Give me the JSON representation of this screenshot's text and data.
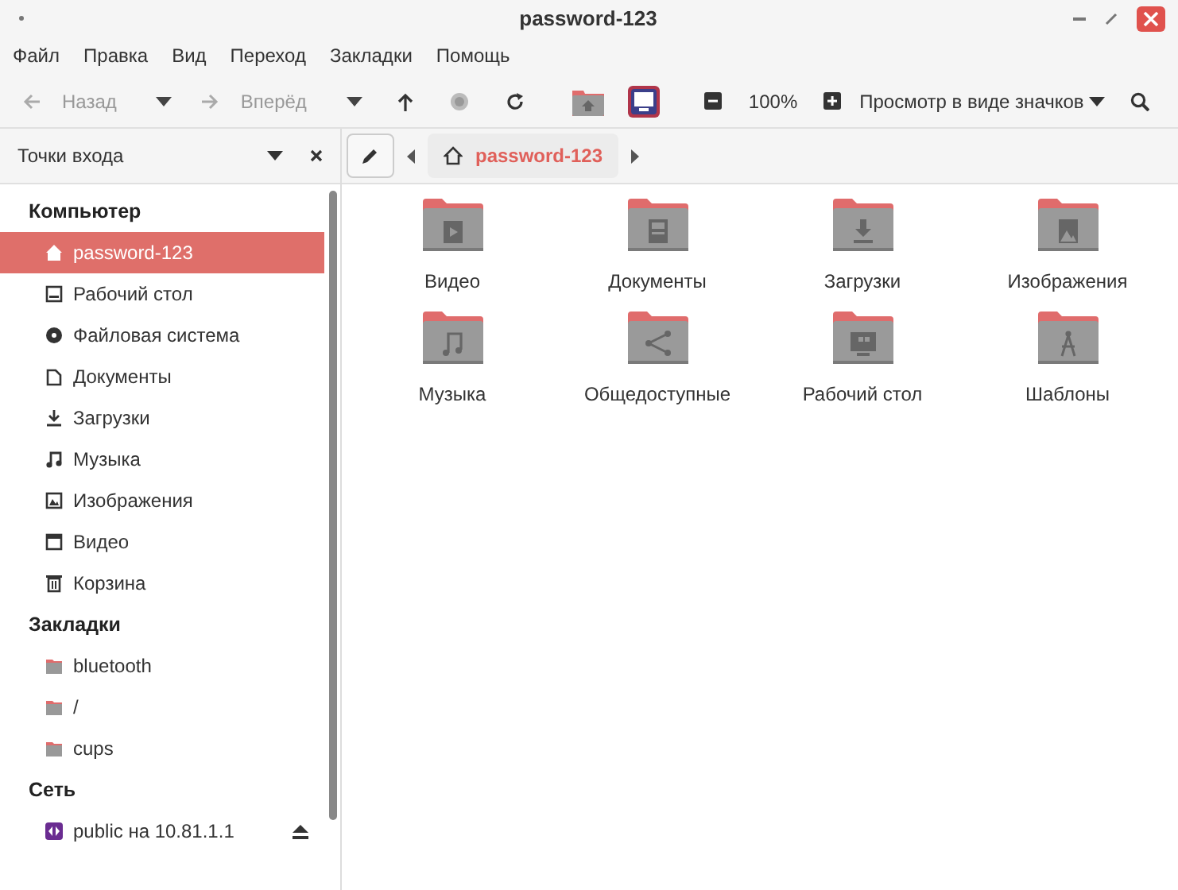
{
  "window": {
    "title": "password-123"
  },
  "menu": [
    "Файл",
    "Правка",
    "Вид",
    "Переход",
    "Закладки",
    "Помощь"
  ],
  "toolbar": {
    "back": {
      "label": "Назад",
      "disabled": true
    },
    "forward": {
      "label": "Вперёд",
      "disabled": true
    },
    "zoom": "100%",
    "view_mode": "Просмотр в виде значков"
  },
  "sidebar": {
    "title": "Точки входа",
    "sections": [
      {
        "title": "Компьютер",
        "items": [
          {
            "label": "password-123",
            "kind": "home",
            "selected": true
          },
          {
            "label": "Рабочий стол",
            "kind": "desktop",
            "selected": false
          },
          {
            "label": "Файловая система",
            "kind": "filesystem",
            "selected": false
          },
          {
            "label": "Документы",
            "kind": "documents",
            "selected": false
          },
          {
            "label": "Загрузки",
            "kind": "downloads",
            "selected": false
          },
          {
            "label": "Музыка",
            "kind": "music",
            "selected": false
          },
          {
            "label": "Изображения",
            "kind": "pictures",
            "selected": false
          },
          {
            "label": "Видео",
            "kind": "video",
            "selected": false
          },
          {
            "label": "Корзина",
            "kind": "trash",
            "selected": false
          }
        ]
      },
      {
        "title": "Закладки",
        "items": [
          {
            "label": "bluetooth",
            "kind": "folder",
            "selected": false
          },
          {
            "label": "/",
            "kind": "folder",
            "selected": false
          },
          {
            "label": "cups",
            "kind": "folder",
            "selected": false
          }
        ]
      },
      {
        "title": "Сеть",
        "items": [
          {
            "label": "public на 10.81.1.1",
            "kind": "share",
            "selected": false,
            "ejectable": true
          }
        ]
      }
    ]
  },
  "breadcrumb": [
    {
      "label": "password-123",
      "selected": true
    }
  ],
  "folders": [
    {
      "label": "Видео",
      "kind": "video"
    },
    {
      "label": "Документы",
      "kind": "documents"
    },
    {
      "label": "Загрузки",
      "kind": "downloads"
    },
    {
      "label": "Изображения",
      "kind": "pictures"
    },
    {
      "label": "Музыка",
      "kind": "music"
    },
    {
      "label": "Общедоступные",
      "kind": "share"
    },
    {
      "label": "Рабочий стол",
      "kind": "desktop"
    },
    {
      "label": "Шаблоны",
      "kind": "templates"
    }
  ]
}
